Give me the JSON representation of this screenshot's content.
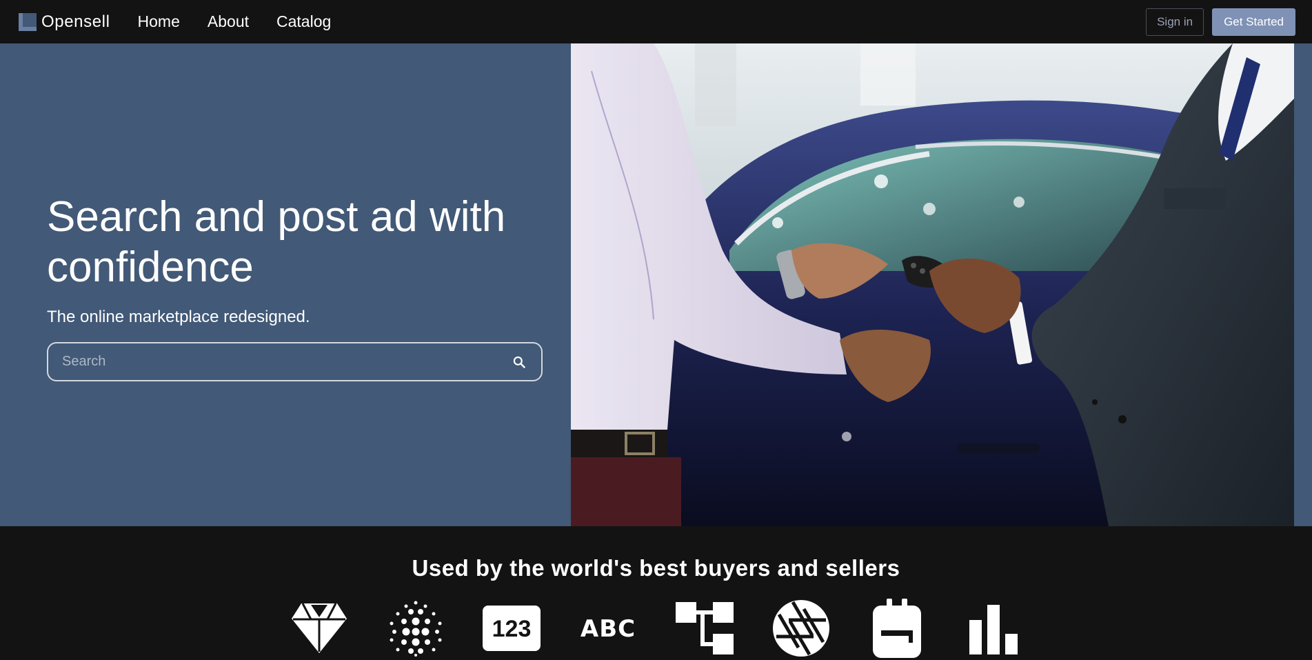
{
  "navbar": {
    "brand_name": "Opensell",
    "links": [
      {
        "label": "Home"
      },
      {
        "label": "About"
      },
      {
        "label": "Catalog"
      }
    ],
    "signin_label": "Sign in",
    "get_started_label": "Get Started"
  },
  "hero": {
    "title": "Search and post ad with confidence",
    "subtitle": "The online marketplace redesigned.",
    "search": {
      "placeholder": "Search",
      "value": ""
    },
    "image_alt": "Handshake with car key exchange in front of a dark blue car"
  },
  "logos": {
    "title": "Used by the world's best buyers and sellers",
    "items": [
      {
        "icon": "diamond-icon"
      },
      {
        "icon": "dot-grid-icon"
      },
      {
        "icon": "numbers-123-icon",
        "text": "123"
      },
      {
        "icon": "letters-abc-icon",
        "text": "ABC"
      },
      {
        "icon": "flowchart-icon"
      },
      {
        "icon": "aperture-icon"
      },
      {
        "icon": "backpack-icon"
      },
      {
        "icon": "bar-chart-icon"
      }
    ]
  },
  "colors": {
    "background": "#131313",
    "hero_background": "#425977",
    "accent_button": "#7f92b6",
    "text": "#ffffff"
  }
}
